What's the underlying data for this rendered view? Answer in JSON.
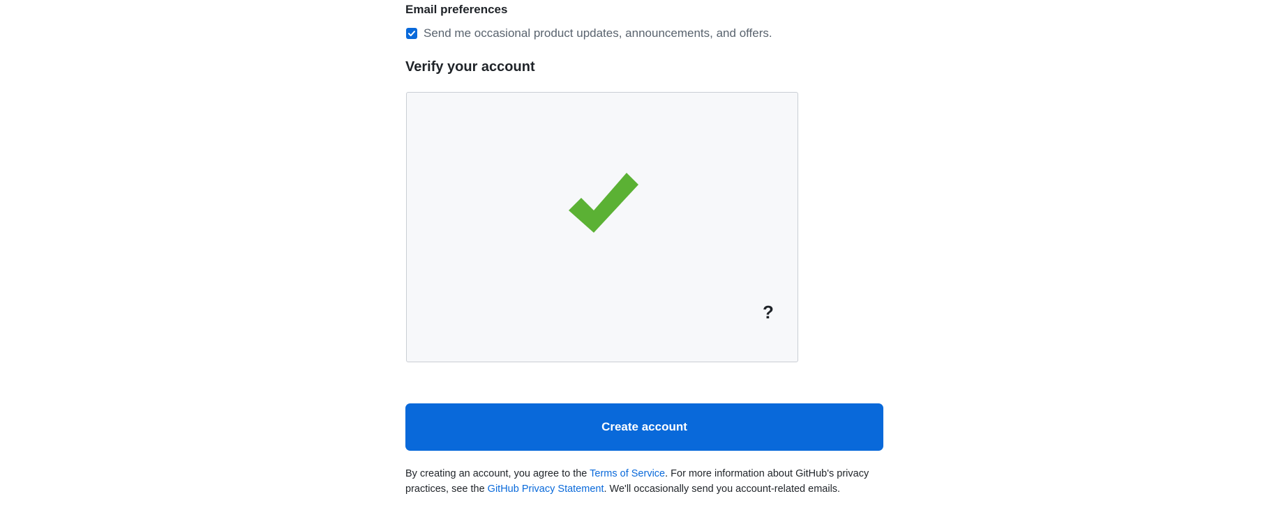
{
  "email_preferences": {
    "label": "Email preferences",
    "checkbox_checked": true,
    "checkbox_text": "Send me occasional product updates, announcements, and offers."
  },
  "verify": {
    "heading": "Verify your account",
    "status_icon": "checkmark-icon",
    "help_text": "?"
  },
  "create_button": {
    "label": "Create account"
  },
  "legal": {
    "part1": "By creating an account, you agree to the ",
    "terms_link": "Terms of Service",
    "part2": ". For more information about GitHub's privacy practices, see the ",
    "privacy_link": "GitHub Privacy Statement",
    "part3": ". We'll occasionally send you account-related emails."
  },
  "colors": {
    "accent": "#0969da",
    "check_green": "#5bb134"
  }
}
